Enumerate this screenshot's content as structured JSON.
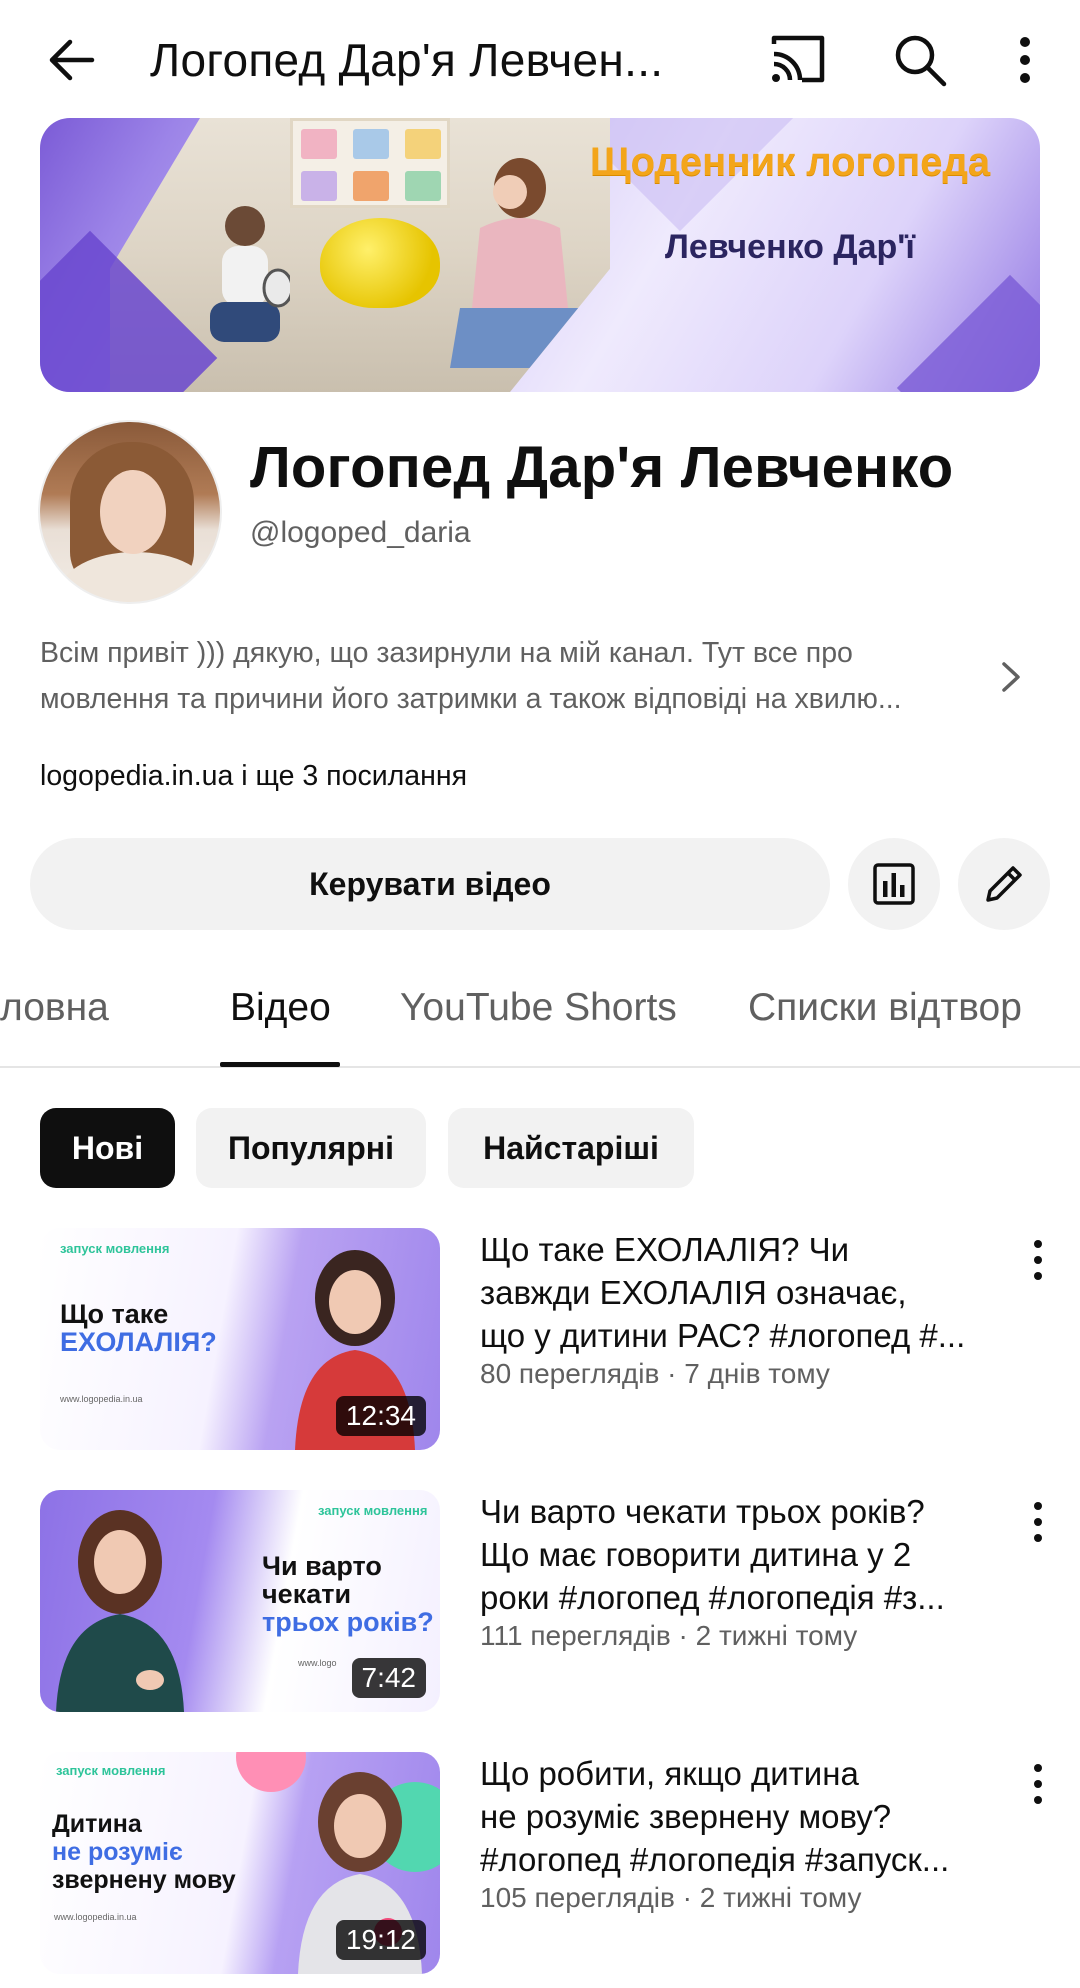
{
  "topbar": {
    "title": "Логопед Дар'я Левчен..."
  },
  "banner": {
    "title": "Щоденник логопеда",
    "subtitle": "Левченко Дар'ї"
  },
  "channel": {
    "name": "Логопед Дар'я Левченко",
    "handle": "@logoped_daria",
    "description_line1": "Всім привіт ))) дякую, що зазирнули на мій канал. Тут все про",
    "description_line2": "мовлення та причини його затримки а також відповіді на хвилю...",
    "links": "logopedia.in.ua і ще 3 посилання",
    "manage_button": "Керувати відео"
  },
  "tabs": [
    {
      "label": "Головна"
    },
    {
      "label": "Відео"
    },
    {
      "label": "YouTube Shorts"
    },
    {
      "label": "Списки відтворення"
    }
  ],
  "tab_display": [
    "ловна",
    "Відео",
    "YouTube Shorts",
    "Списки відтвор"
  ],
  "active_tab": "Відео",
  "chips": [
    {
      "label": "Нові",
      "active": true
    },
    {
      "label": "Популярні",
      "active": false
    },
    {
      "label": "Найстаріші",
      "active": false
    }
  ],
  "videos": [
    {
      "title_lines": [
        "Що таке ЕХОЛАЛІЯ? Чи",
        "завжди ЕХОЛАЛІЯ означає,",
        "що у дитини РАС? #логопед #..."
      ],
      "meta": "80 переглядів · 7 днів тому",
      "duration": "12:34",
      "thumb": {
        "logo": "запуск мовлення",
        "line1": "Що таке",
        "line2": "ЕХОЛАЛІЯ?",
        "url": "www.logopedia.in.ua"
      }
    },
    {
      "title_lines": [
        "Чи варто чекати трьох років?",
        "Що має говорити дитина у 2",
        "роки #логопед #логопедія #з..."
      ],
      "meta": "111 переглядів · 2 тижні тому",
      "duration": "7:42",
      "thumb": {
        "logo": "запуск мовлення",
        "line1": "Чи варто",
        "line2": "чекати",
        "line3": "трьох років?",
        "url": "www.logo"
      }
    },
    {
      "title_lines": [
        "Що робити, якщо дитина",
        "не розуміє звернену мову?",
        "#логопед #логопедія #запуск..."
      ],
      "meta": "105 переглядів · 2 тижні тому",
      "duration": "19:12",
      "thumb": {
        "logo": "запуск мовлення",
        "line1": "Дитина",
        "line2": "не розуміє",
        "line3": "звернену мову",
        "url": "www.logopedia.in.ua"
      }
    }
  ],
  "colors": {
    "text_primary": "#0f0f0f",
    "text_secondary": "#606060",
    "chip_bg": "#f2f2f2",
    "banner_accent": "#f3a51a",
    "banner_purple": "#7b5bd6"
  },
  "icons": [
    "back-arrow-icon",
    "cast-icon",
    "search-icon",
    "more-vertical-icon",
    "chevron-right-icon",
    "stats-icon",
    "pencil-icon"
  ]
}
